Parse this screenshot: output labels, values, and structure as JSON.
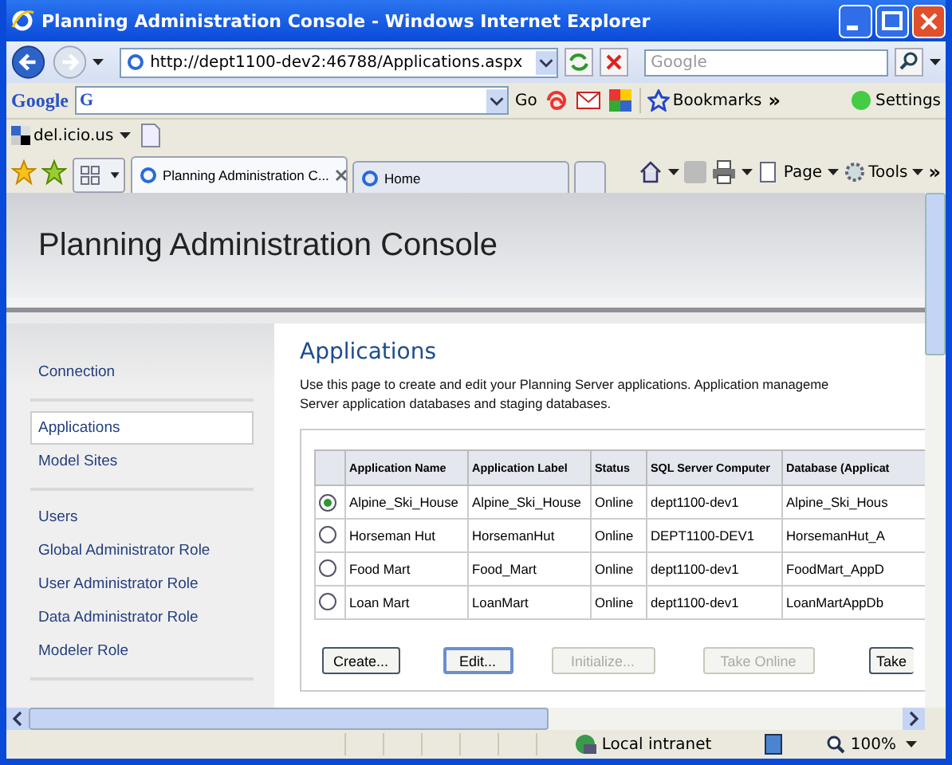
{
  "window": {
    "title": "Planning Administration Console - Windows Internet Explorer"
  },
  "address_bar": {
    "url": "http://dept1100-dev2:46788/Applications.aspx",
    "search_placeholder": "Google"
  },
  "google_toolbar": {
    "logo": "Google",
    "g_button": "G",
    "go": "Go",
    "bookmarks": "Bookmarks",
    "more": "»",
    "settings": "Settings"
  },
  "links_bar": {
    "label": "del.icio.us"
  },
  "tabs": [
    {
      "label": "Planning Administration C...",
      "selected": true,
      "closable": true
    },
    {
      "label": "Home",
      "selected": false,
      "closable": false
    }
  ],
  "command_bar": {
    "page": "Page",
    "tools": "Tools",
    "more": "»"
  },
  "page": {
    "title": "Planning Administration Console"
  },
  "sidebar": {
    "groups": [
      [
        {
          "label": "Connection",
          "selected": false
        }
      ],
      [
        {
          "label": "Applications",
          "selected": true
        },
        {
          "label": "Model Sites",
          "selected": false
        }
      ],
      [
        {
          "label": "Users",
          "selected": false
        },
        {
          "label": "Global Administrator Role",
          "selected": false
        },
        {
          "label": "User Administrator Role",
          "selected": false
        },
        {
          "label": "Data Administrator Role",
          "selected": false
        },
        {
          "label": "Modeler Role",
          "selected": false
        }
      ]
    ]
  },
  "main": {
    "heading": "Applications",
    "description": [
      "Use this page to create and edit your Planning Server applications. Application manageme",
      "Server application databases and staging databases."
    ],
    "table": {
      "columns": [
        "Application Name",
        "Application Label",
        "Status",
        "SQL Server Computer",
        "Database (Applicat"
      ],
      "rows": [
        {
          "selected": true,
          "cells": [
            "Alpine_Ski_House",
            "Alpine_Ski_House",
            "Online",
            "dept1100-dev1",
            "Alpine_Ski_Hous"
          ]
        },
        {
          "selected": false,
          "cells": [
            "Horseman Hut",
            "HorsemanHut",
            "Online",
            "DEPT1100-DEV1",
            "HorsemanHut_A"
          ]
        },
        {
          "selected": false,
          "cells": [
            "Food Mart",
            "Food_Mart",
            "Online",
            "dept1100-dev1",
            "FoodMart_AppD"
          ]
        },
        {
          "selected": false,
          "cells": [
            "Loan Mart",
            "LoanMart",
            "Online",
            "dept1100-dev1",
            "LoanMartAppDb"
          ]
        }
      ]
    },
    "buttons": [
      {
        "label": "Create...",
        "disabled": false,
        "focused": false
      },
      {
        "label": "Edit...",
        "disabled": false,
        "focused": true
      },
      {
        "label": "Initialize...",
        "disabled": true,
        "focused": false
      },
      {
        "label": "Take Online",
        "disabled": true,
        "focused": false
      },
      {
        "label": "Take",
        "disabled": false,
        "focused": false
      }
    ]
  },
  "status_bar": {
    "zone": "Local intranet",
    "zoom": "100%"
  }
}
